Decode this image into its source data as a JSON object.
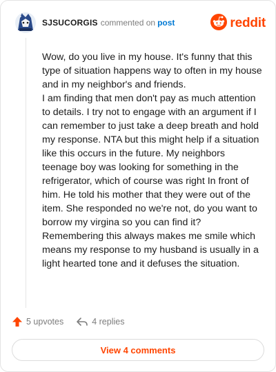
{
  "header": {
    "username": "SJSUCORGIS",
    "action": "commented on",
    "post_link": "post",
    "brand": "reddit"
  },
  "comment": {
    "paragraphs": [
      "Wow, do you live in my house. It's funny that this type of situation happens way to often in my house and in my neighbor's and friends.",
      "I am finding that men don't pay as much attention to details. I try not to engage with an argument if I can remember to just take a deep breath and hold my response. NTA but this might help if a situation like this occurs in the future. My neighbors teenage boy was looking for something in the refrigerator, which of course was right In front of him. He told his mother that they were out of the item. She responded no we're not, do you want to borrow my virgina so you can find it? Remembering this always makes me smile which means my response to my husband is usually in a light hearted tone and it defuses the situation."
    ]
  },
  "footer": {
    "upvotes": "5 upvotes",
    "replies": "4 replies"
  },
  "view_button": "View 4 comments",
  "colors": {
    "accent": "#ff4500",
    "link": "#0079d3",
    "muted": "#7c7c7c",
    "text": "#1c1c1c"
  },
  "icons": {
    "avatar": "avatar-icon",
    "brand": "reddit-logo-icon",
    "upvote": "upvote-arrow-icon",
    "reply": "reply-arrow-icon"
  }
}
